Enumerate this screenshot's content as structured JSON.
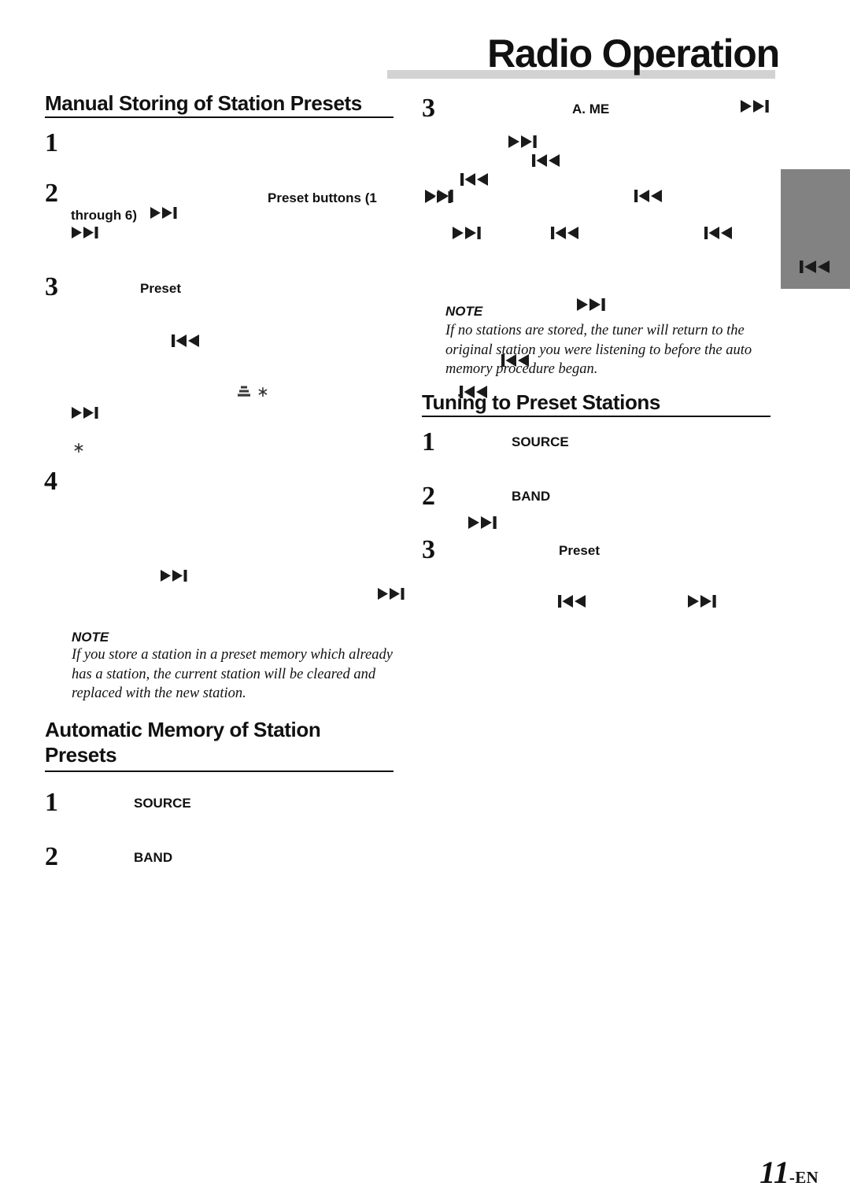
{
  "page": {
    "title": "Radio Operation",
    "folio_number": "11",
    "folio_suffix": "-EN",
    "accent_bar_color": "#d2d2d2",
    "tab_color": "#828282"
  },
  "sections": [
    {
      "id": "manual-storing",
      "heading": "Manual Storing of Station Presets",
      "steps": [
        {
          "number": "1",
          "fragments": []
        },
        {
          "number": "2",
          "fragments": [
            "Preset buttons (1",
            "through 6)"
          ]
        },
        {
          "number": "3",
          "fragments": [
            "Preset"
          ]
        },
        {
          "number": "4",
          "fragments": []
        }
      ],
      "note": {
        "label": "NOTE",
        "lines": [
          "If you store a station in a preset memory which already",
          "has a station, the current station will be cleared and",
          "replaced with the new station."
        ]
      }
    },
    {
      "id": "automatic-memory",
      "heading_line1": "Automatic Memory of Station",
      "heading_line2": "Presets",
      "steps": [
        {
          "number": "1",
          "fragments": [
            "SOURCE"
          ]
        },
        {
          "number": "2",
          "fragments": [
            "BAND"
          ]
        },
        {
          "number": "3",
          "fragments": [
            "A. ME"
          ]
        }
      ],
      "note": {
        "label": "NOTE",
        "lines": [
          "If no stations are stored, the tuner will return to the",
          "original station you were listening to before the auto",
          "memory procedure began."
        ]
      }
    },
    {
      "id": "tuning-presets",
      "heading": "Tuning to Preset Stations",
      "steps": [
        {
          "number": "1",
          "fragments": [
            "SOURCE"
          ]
        },
        {
          "number": "2",
          "fragments": [
            "BAND"
          ]
        },
        {
          "number": "3",
          "fragments": [
            "Preset"
          ]
        }
      ]
    }
  ],
  "labels": {
    "through_6": "through 6)",
    "preset_buttons_1": "Preset buttons (1",
    "preset": "Preset",
    "source": "SOURCE",
    "band": "BAND",
    "a_me": "A. ME",
    "note": "NOTE",
    "asterisk": "∗"
  },
  "icons": {
    "next_track": "next-track-icon",
    "prev_track": "prev-track-icon",
    "list": "list-glyph-icon"
  }
}
